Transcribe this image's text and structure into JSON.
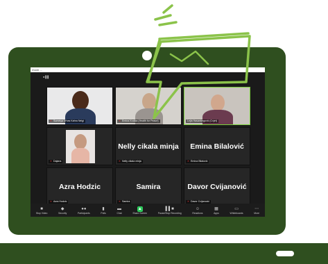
{
  "window": {
    "title": "Zoom ..."
  },
  "participants": [
    {
      "name": "Sumeiya Vrhas Kahra Nelgi",
      "has_video": true
    },
    {
      "name": "Emina Kruška (Health for Peace)",
      "has_video": true
    },
    {
      "name": "Lejla Hasanbegović (Cvjet)",
      "has_video": true,
      "active_speaker": true
    },
    {
      "name": "Dajana",
      "has_video": true
    },
    {
      "name": "Nelly cikala minja",
      "has_video": false
    },
    {
      "name": "Emina Bilalović",
      "has_video": false
    },
    {
      "name": "Azra Hodzic",
      "has_video": false
    },
    {
      "name": "Samira",
      "has_video": false
    },
    {
      "name": "Davor Cvijanović",
      "has_video": false
    }
  ],
  "toolbar": {
    "stop_video": "Stop Video",
    "security": "Security",
    "participants": "Participants",
    "polls": "Polls",
    "chat": "Chat",
    "share_screen": "Share Screen",
    "pause_recording": "Pause/Stop Recording",
    "reactions": "Reactions",
    "apps": "Apps",
    "whiteboards": "Whiteboards",
    "more": "More"
  },
  "colors": {
    "frame": "#2f4f1f",
    "accent": "#7ad13b",
    "speech_bubble": "#8bc34a"
  }
}
